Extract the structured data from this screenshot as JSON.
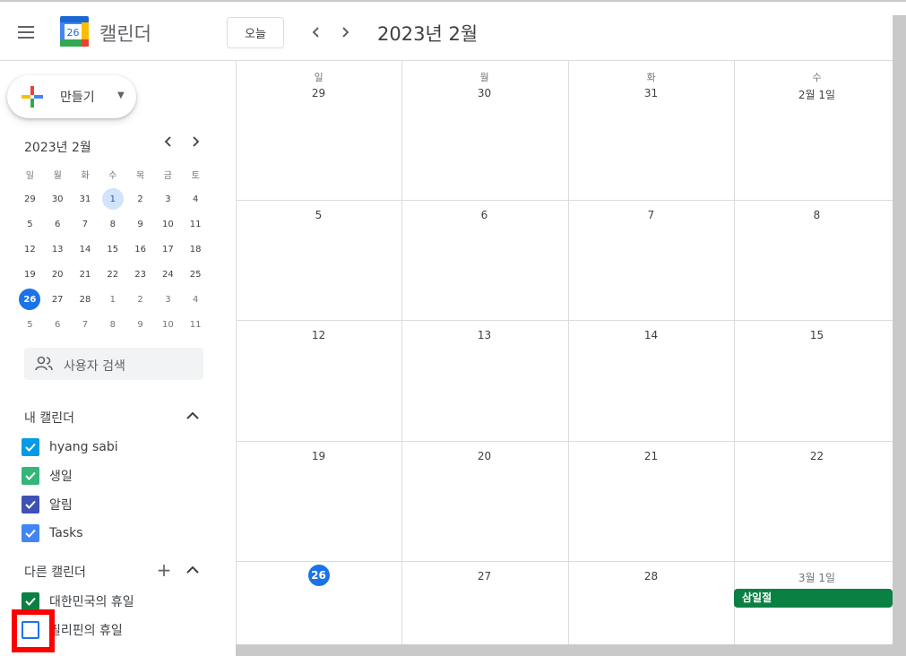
{
  "header": {
    "app_name": "캘린더",
    "logo_text": "26",
    "today_label": "오늘",
    "month_title": "2023년 2월"
  },
  "sidebar": {
    "create_label": "만들기",
    "mini_calendar": {
      "title": "2023년 2월",
      "weekdays": [
        "일",
        "월",
        "화",
        "수",
        "목",
        "금",
        "토"
      ],
      "weeks": [
        [
          "29",
          "30",
          "31",
          "1",
          "2",
          "3",
          "4"
        ],
        [
          "5",
          "6",
          "7",
          "8",
          "9",
          "10",
          "11"
        ],
        [
          "12",
          "13",
          "14",
          "15",
          "16",
          "17",
          "18"
        ],
        [
          "19",
          "20",
          "21",
          "22",
          "23",
          "24",
          "25"
        ],
        [
          "26",
          "27",
          "28",
          "1",
          "2",
          "3",
          "4"
        ],
        [
          "5",
          "6",
          "7",
          "8",
          "9",
          "10",
          "11"
        ]
      ]
    },
    "search_people": "사용자 검색",
    "my_calendars": {
      "title": "내 캘린더",
      "items": [
        {
          "name": "hyang sabi",
          "color": "#039be5",
          "checked": true
        },
        {
          "name": "생일",
          "color": "#33b679",
          "checked": true
        },
        {
          "name": "알림",
          "color": "#3f51b5",
          "checked": true
        },
        {
          "name": "Tasks",
          "color": "#4285f4",
          "checked": true
        }
      ]
    },
    "other_calendars": {
      "title": "다른 캘린더",
      "items": [
        {
          "name": "대한민국의 휴일",
          "color": "#0b8043",
          "checked": true
        },
        {
          "name": "필리핀의 휴일",
          "color": "#1a73e8",
          "checked": false
        }
      ]
    }
  },
  "month_grid": {
    "weekdays": [
      "일",
      "월",
      "화",
      "수"
    ],
    "weeks": [
      [
        "29",
        "30",
        "31",
        "2월 1일"
      ],
      [
        "5",
        "6",
        "7",
        "8"
      ],
      [
        "12",
        "13",
        "14",
        "15"
      ],
      [
        "19",
        "20",
        "21",
        "22"
      ],
      [
        "26",
        "27",
        "28",
        "3월 1일"
      ]
    ],
    "event": {
      "title": "삼일절",
      "color": "#0b8043"
    }
  }
}
